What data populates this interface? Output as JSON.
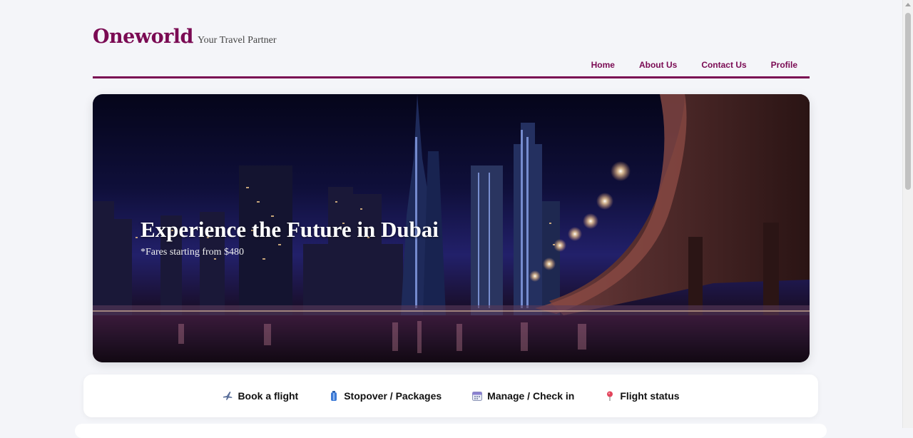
{
  "brand": {
    "name": "Oneworld",
    "tagline": "Your Travel Partner",
    "color": "#7a0a53"
  },
  "nav": {
    "items": [
      "Home",
      "About Us",
      "Contact Us",
      "Profile"
    ]
  },
  "hero": {
    "title": "Experience the Future in Dubai",
    "subtitle": "*Fares starting from $480"
  },
  "tabs": [
    {
      "label": "Book a flight",
      "icon": "airplane-icon"
    },
    {
      "label": "Stopover / Packages",
      "icon": "luggage-icon"
    },
    {
      "label": "Manage / Check in",
      "icon": "calendar-icon"
    },
    {
      "label": "Flight status",
      "icon": "pin-icon"
    }
  ]
}
